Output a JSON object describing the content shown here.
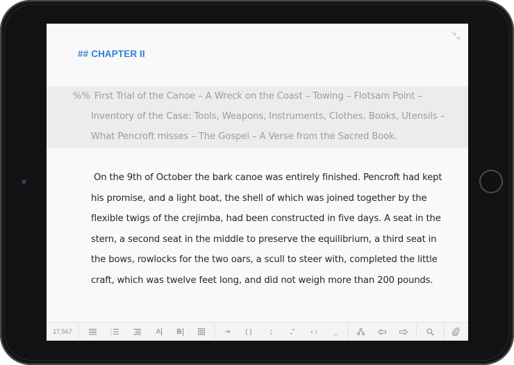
{
  "document": {
    "heading_markup": "##",
    "heading_text": "CHAPTER II",
    "summary_markup": "%%",
    "summary_lines": [
      "First Trial of the Canoe – A Wreck on the Coast – Towing – Flotsam Point –",
      "Inventory of the Case: Tools, Weapons, Instruments, Clothes, Books, Utensils –",
      "What Pencroft misses – The Gospel – A Verse from the Sacred Book."
    ],
    "body_lines": [
      " On the 9th of October the bark canoe was entirely finished. Pencroft had kept",
      "his promise, and a light boat, the shell of which was joined together by the",
      "flexible twigs of the crejimba, had been constructed in five days. A seat in the",
      "stern, a second seat in the middle to preserve the equilibrium, a third seat in",
      "the bows, rowlocks for the two oars, a scull to steer with, completed the little",
      "craft, which was twelve feet long, and did not weigh more than 200 pounds."
    ]
  },
  "toolbar": {
    "word_count": "17,567",
    "buttons": {
      "header": {
        "icon": "header-lines-icon"
      },
      "list": {
        "icon": "ordered-list-icon"
      },
      "quote": {
        "icon": "quote-lines-icon"
      },
      "bold_a": {
        "label": "A",
        "icon": "format-a-icon"
      },
      "bold_b": {
        "label": "B",
        "icon": "format-b-icon"
      },
      "grid": {
        "icon": "grid-icon"
      },
      "tab": {
        "label": "⇥",
        "icon": "tab-icon"
      },
      "parens": {
        "label": "( )",
        "icon": "parentheses-icon"
      },
      "semicolon": {
        "label": ";",
        "icon": "semicolon-icon"
      },
      "quotes": {
        "label": "„\"",
        "icon": "quotes-icon"
      },
      "angles": {
        "label": "‹ ›",
        "icon": "angle-brackets-icon"
      },
      "underscore": {
        "label": "_",
        "icon": "underscore-icon"
      },
      "share": {
        "icon": "share-nodes-icon"
      },
      "cursor_left": {
        "icon": "arrow-left-icon"
      },
      "cursor_right": {
        "icon": "arrow-right-icon"
      },
      "search": {
        "icon": "search-icon"
      },
      "attach": {
        "icon": "paperclip-icon"
      }
    }
  },
  "colors": {
    "heading": "#2f7fd6",
    "summary_text": "#9c9c9c",
    "summary_background": "#ececec",
    "body_text": "#262626",
    "device_bezel": "#121214"
  }
}
